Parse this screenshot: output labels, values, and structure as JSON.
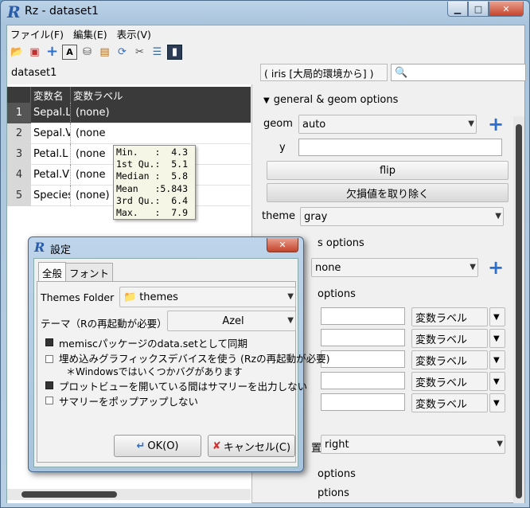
{
  "window": {
    "title": "Rz - dataset1"
  },
  "menu": {
    "items": [
      "ファイル(F)",
      "編集(E)",
      "表示(V)"
    ]
  },
  "toolbar": {
    "icons": [
      "folder-icon",
      "save-icon",
      "add-icon",
      "text-icon",
      "database-icon",
      "image-icon",
      "refresh-icon",
      "tools-icon",
      "list-icon",
      "chart-icon"
    ]
  },
  "dataset": {
    "label": "dataset1",
    "combo": "( iris [大局的環境から] )",
    "search_placeholder": ""
  },
  "grid": {
    "headers": [
      "変数名",
      "変数ラベル"
    ],
    "rows": [
      {
        "n": "1",
        "name": "Sepal.L",
        "label": "(none)"
      },
      {
        "n": "2",
        "name": "Sepal.V",
        "label": "(none"
      },
      {
        "n": "3",
        "name": "Petal.L",
        "label": "(none"
      },
      {
        "n": "4",
        "name": "Petal.V",
        "label": "(none"
      },
      {
        "n": "5",
        "name": "Species",
        "label": "(none)"
      }
    ],
    "tooltip": "Min.   :  4.3\n1st Qu.:  5.1\nMedian :  5.8\nMean   :5.843\n3rd Qu.:  6.4\nMax.   :  7.9"
  },
  "right": {
    "sec1": "general & geom options",
    "geom_label": "geom",
    "geom_value": "auto",
    "y_label": "y",
    "flip": "flip",
    "na_btn": "欠損値を取り除く",
    "theme_label": "theme",
    "theme_value": "gray",
    "sec2_partial": "s options",
    "none_value": "none",
    "sec3_partial": "options",
    "label_rows": [
      "変数ラベル",
      "変数ラベル",
      "変数ラベル",
      "変数ラベル",
      "変数ラベル"
    ],
    "pos_partial": "置",
    "pos_value": "right",
    "sec4_partial": "options",
    "sec5_partial": "ptions"
  },
  "dialog": {
    "title": "設定",
    "tabs": [
      "全般",
      "フォント"
    ],
    "themes_folder_label": "Themes Folder",
    "themes_folder_value": "themes",
    "theme_label": "テーマ（Rの再起動が必要）",
    "theme_value": "Azel",
    "checks": [
      {
        "label": "memiscパッケージのdata.setとして同期",
        "checked": true
      },
      {
        "label": "埋め込みグラフィックスデバイスを使う (Rzの再起動が必要)",
        "checked": false
      },
      {
        "label": "プロットビューを開いている間はサマリーを出力しない",
        "checked": true
      },
      {
        "label": "サマリーをポップアップしない",
        "checked": false
      }
    ],
    "note": "＊Windowsではいくつかバグがあります",
    "ok": "OK(O)",
    "cancel": "キャンセル(C)"
  }
}
